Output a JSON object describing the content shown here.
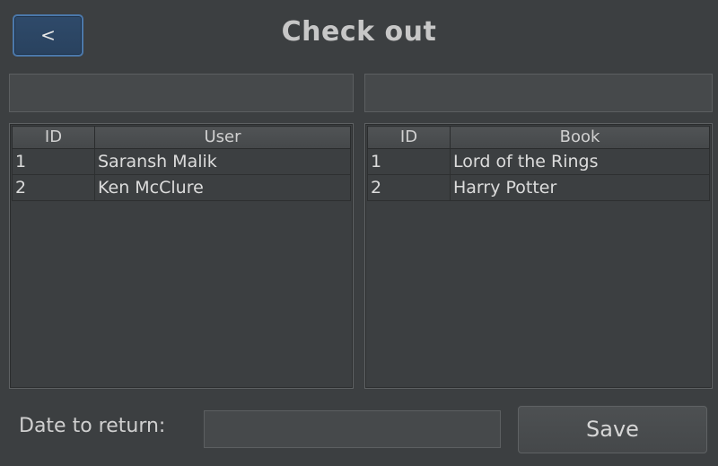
{
  "header": {
    "back_label": "<",
    "title": "Check out"
  },
  "user_search": {
    "value": ""
  },
  "book_search": {
    "value": ""
  },
  "users_table": {
    "columns": [
      "ID",
      "User"
    ],
    "rows": [
      [
        "1",
        "Saransh Malik"
      ],
      [
        "2",
        "Ken McClure"
      ]
    ]
  },
  "books_table": {
    "columns": [
      "ID",
      "Book"
    ],
    "rows": [
      [
        "1",
        "Lord of the Rings"
      ],
      [
        "2",
        "Harry Potter"
      ]
    ]
  },
  "footer": {
    "date_label": "Date to return:",
    "date_value": "",
    "save_label": "Save"
  }
}
